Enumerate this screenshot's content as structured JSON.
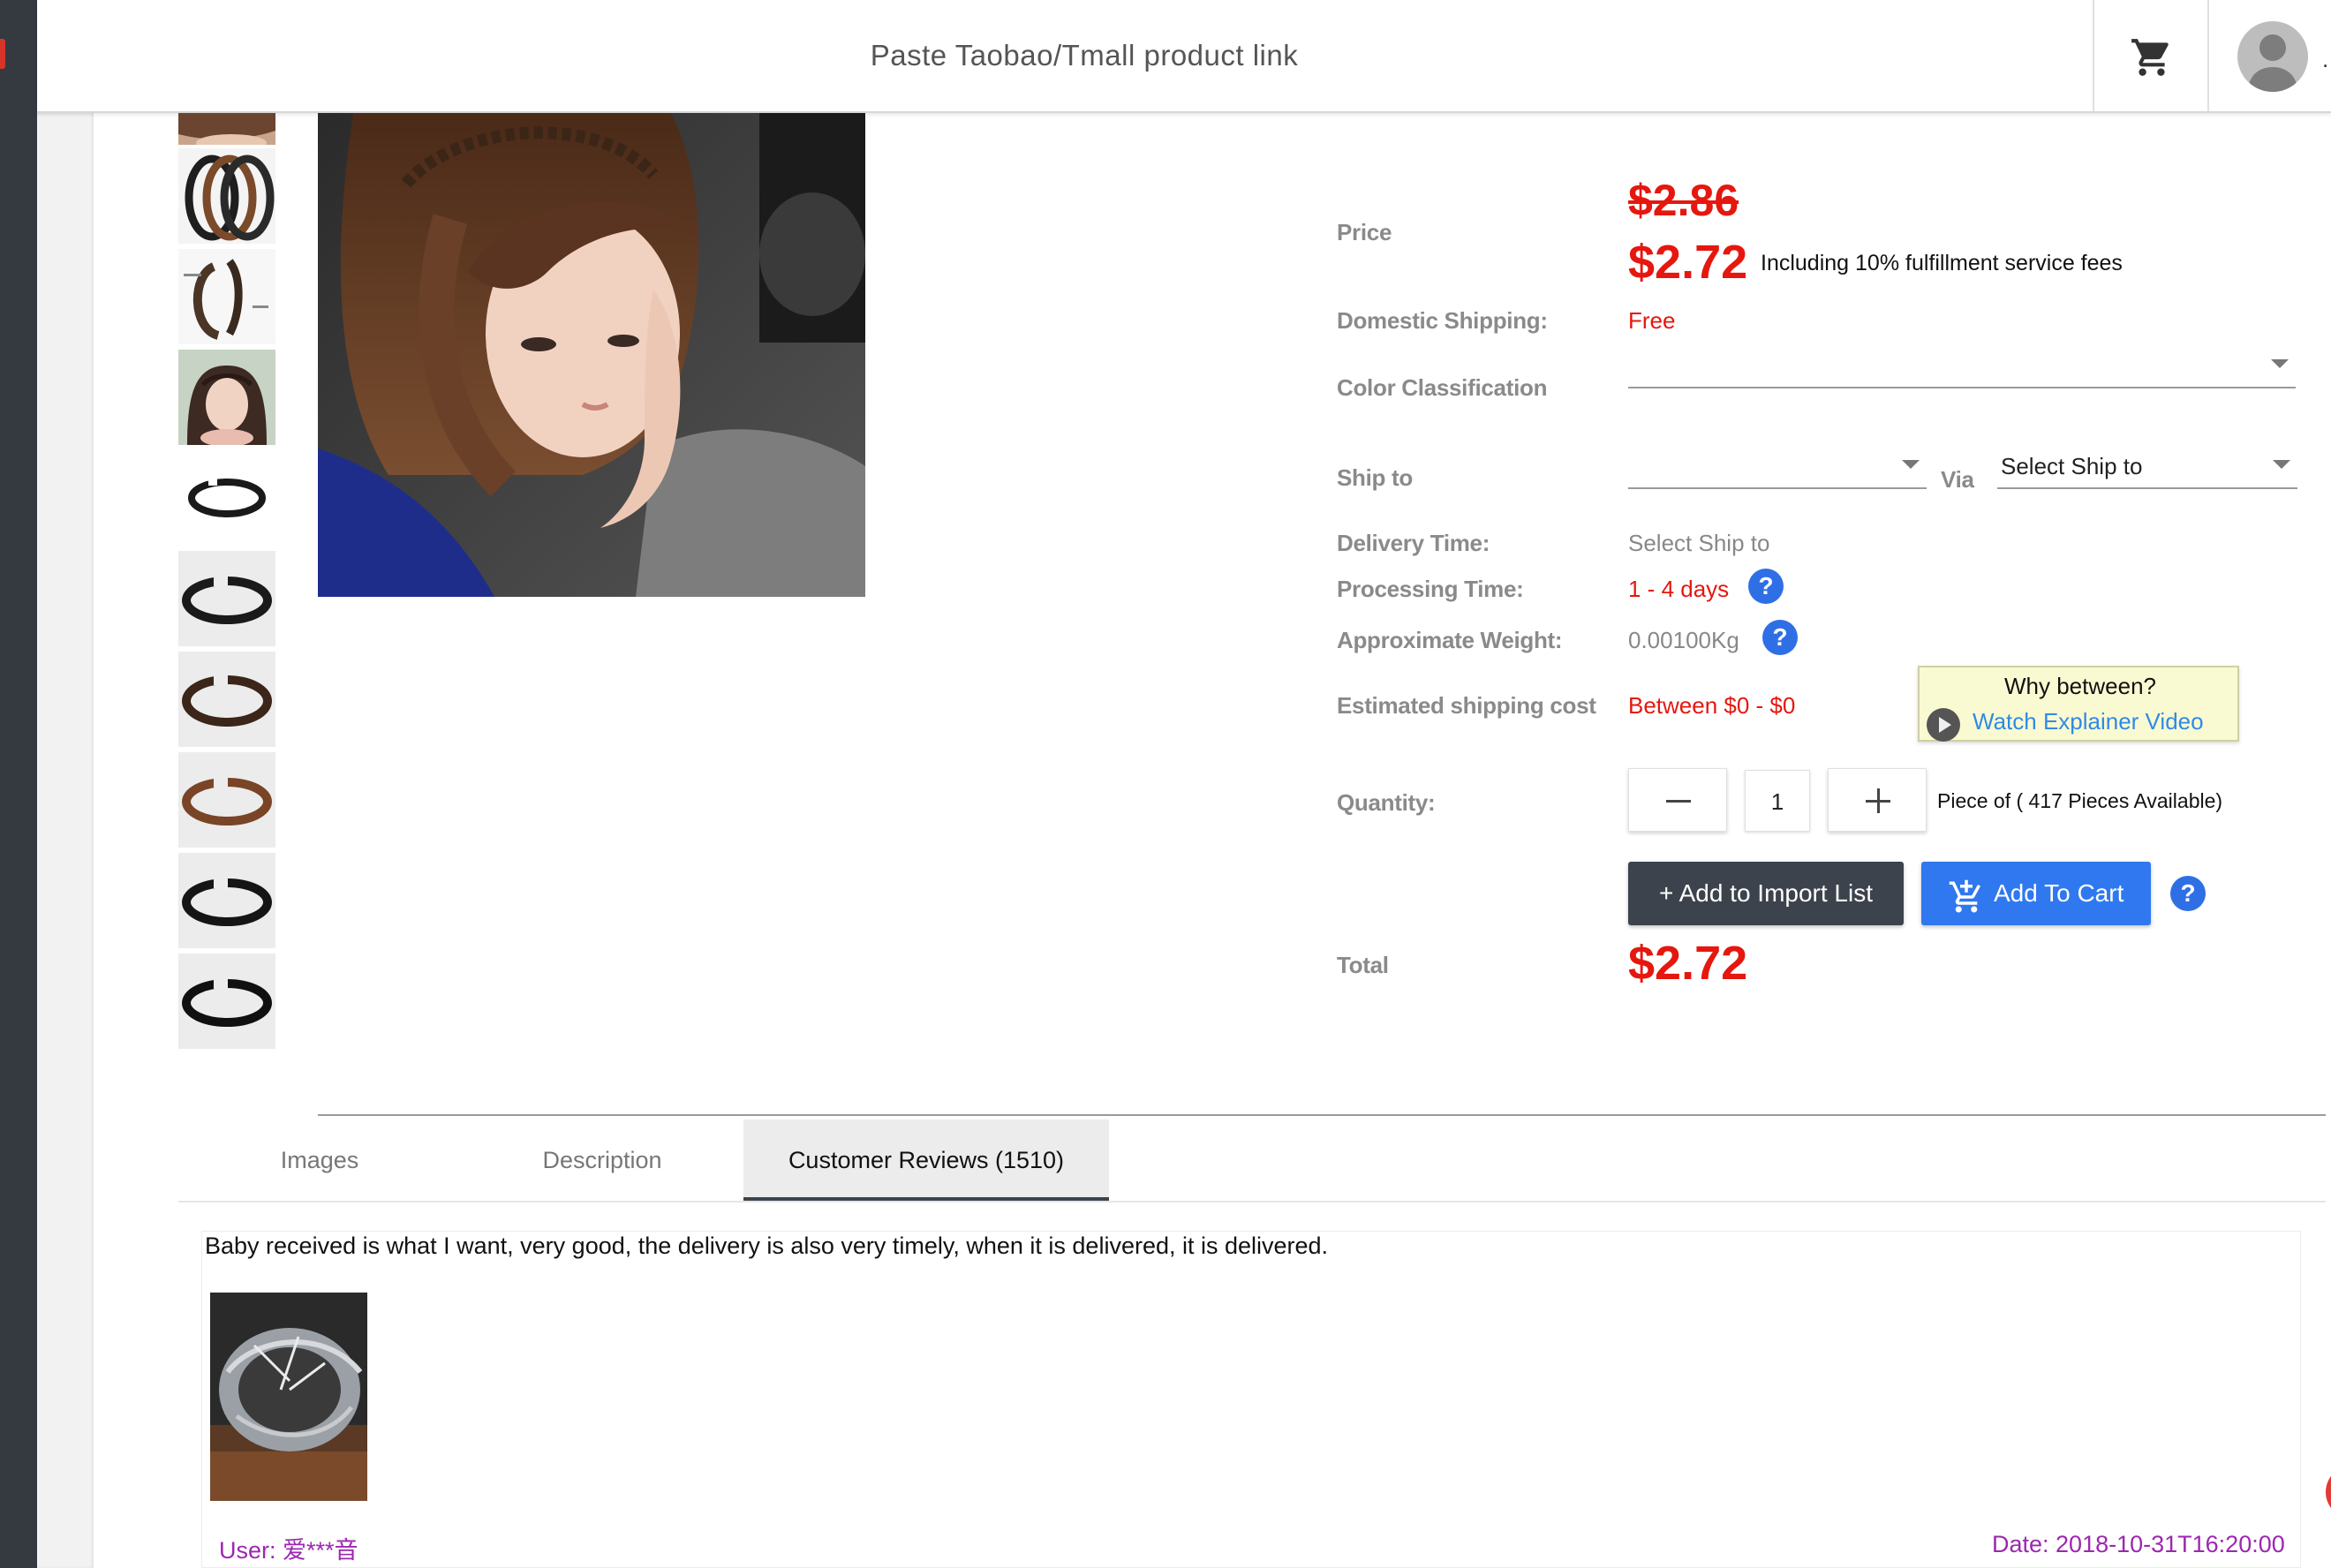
{
  "header": {
    "search_placeholder": "Paste Taobao/Tmall product link",
    "cart_icon": "shopping-cart-icon",
    "avatar_icon": "user-avatar-icon",
    "trailing_text": "."
  },
  "gallery": {
    "thumbnails": [
      "thumbnail-hair-model",
      "thumbnail-braided-headbands-set",
      "thumbnail-headband-size-chart",
      "thumbnail-model-wearing-headband",
      "thumbnail-single-headband",
      "thumbnail-dark-headband",
      "thumbnail-brown-headband",
      "thumbnail-light-brown-headband",
      "thumbnail-black-headband",
      "thumbnail-black-headband-2"
    ],
    "main_image": "model-wearing-braided-headband"
  },
  "product": {
    "price_label": "Price",
    "original_price": "$2.86",
    "price": "$2.72",
    "fee_note": "Including 10% fulfillment service fees",
    "domestic_shipping_label": "Domestic Shipping:",
    "domestic_shipping_value": "Free",
    "color_label": "Color Classification",
    "color_value": "",
    "ship_to_label": "Ship to",
    "ship_to_value": "",
    "via_label": "Via",
    "via_value": "Select Ship to",
    "delivery_time_label": "Delivery Time:",
    "delivery_time_value": "Select Ship to",
    "processing_time_label": "Processing Time:",
    "processing_time_value": "1 - 4 days",
    "weight_label": "Approximate Weight:",
    "weight_value": "0.00100Kg",
    "shipping_cost_label": "Estimated shipping cost",
    "shipping_cost_value": "Between $0 - $0",
    "tooltip_title": "Why between?",
    "tooltip_link": "Watch Explainer Video",
    "quantity_label": "Quantity:",
    "quantity_value": "1",
    "quantity_note": "Piece of ( 417 Pieces Available)",
    "import_button": "+ Add to Import List",
    "cart_button": "Add To Cart",
    "total_label": "Total",
    "total_value": "$2.72",
    "help_icon": "?"
  },
  "tabs": [
    {
      "label": "Images"
    },
    {
      "label": "Description"
    },
    {
      "label": "Customer Reviews (1510)"
    }
  ],
  "review": {
    "text": "Baby received is what I want, very good, the delivery is also very timely, when it is delivered, it is delivered.",
    "image": "review-photo-headband",
    "user": "User: 爱***音",
    "date": "Date: 2018-10-31T16:20:00"
  },
  "colors": {
    "accent_blue": "#2f78f0",
    "price_red": "#e5170f",
    "dark_button": "#3c434d",
    "review_purple": "#9c27b0"
  }
}
